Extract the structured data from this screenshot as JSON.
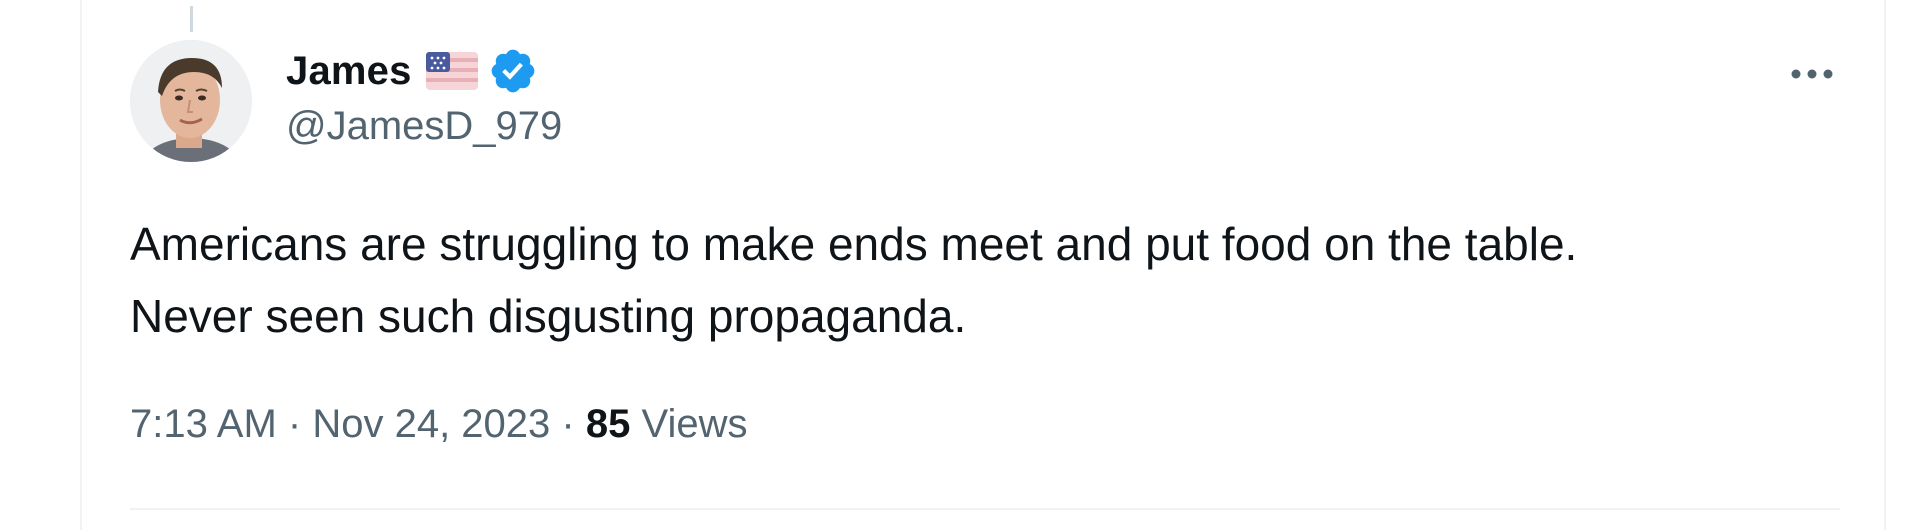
{
  "tweet": {
    "author": {
      "display_name": "James",
      "handle": "@JamesD_979",
      "flag_icon": "us-flag-icon",
      "verified_icon": "verified-badge-icon",
      "verified_color": "#1d9bf0"
    },
    "text_lines": [
      "Americans are struggling to make ends meet and put food on the table.",
      "Never seen such disgusting propaganda."
    ],
    "timestamp": "7:13 AM",
    "separator": "·",
    "date": "Nov 24, 2023",
    "views_count": "85",
    "views_label": "Views",
    "more_icon": "more-horizontal-icon"
  },
  "colors": {
    "primary_text": "#0f1419",
    "secondary_text": "#536471",
    "border": "#eff3f4"
  }
}
